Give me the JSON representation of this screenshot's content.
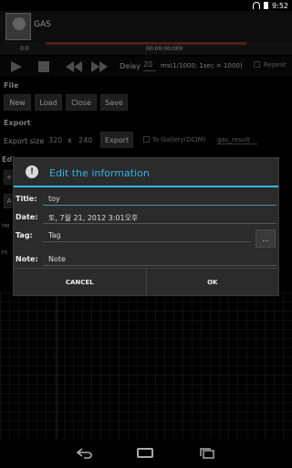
{
  "status": {
    "time": "9:52"
  },
  "app": {
    "title": "GAS"
  },
  "timeline": {
    "left_time": "0:0",
    "center_time": "00:00:00:000"
  },
  "transport": {
    "delay_label": "Delay",
    "delay_value": "20",
    "delay_unit": "ms(1/1000; 1sec = 1000)",
    "repeat_label": "Repeat"
  },
  "file": {
    "section_label": "File",
    "buttons": [
      "New",
      "Load",
      "Close",
      "Save"
    ]
  },
  "export": {
    "section_label": "Export",
    "size_label": "Export size",
    "width": "320",
    "x": "x",
    "height": "240",
    "export_button": "Export",
    "gallery_label": "To Gallery(DCIM)",
    "result_name": "gas_result"
  },
  "edit": {
    "section_label": "Edi",
    "plus_label": "+",
    "a_label": "A",
    "tag_row_label": "tag",
    "fx_row_label": "FX"
  },
  "dialog": {
    "title": "Edit the information",
    "title_color": "#33b5e5",
    "fields": {
      "title_label": "Title:",
      "title_value": "toy",
      "date_label": "Date:",
      "date_value": "토, 7월 21, 2012 3:01오후",
      "tag_label": "Tag:",
      "tag_value": "Tag",
      "tag_more": "...",
      "note_label": "Note:",
      "note_value": "Note"
    },
    "cancel_label": "CANCEL",
    "ok_label": "OK"
  },
  "icons": [
    "wifi-icon",
    "battery-icon",
    "play-icon",
    "stop-icon",
    "rewind-icon",
    "fast-forward-icon",
    "alert-icon",
    "back-icon",
    "home-icon",
    "recent-apps-icon"
  ]
}
